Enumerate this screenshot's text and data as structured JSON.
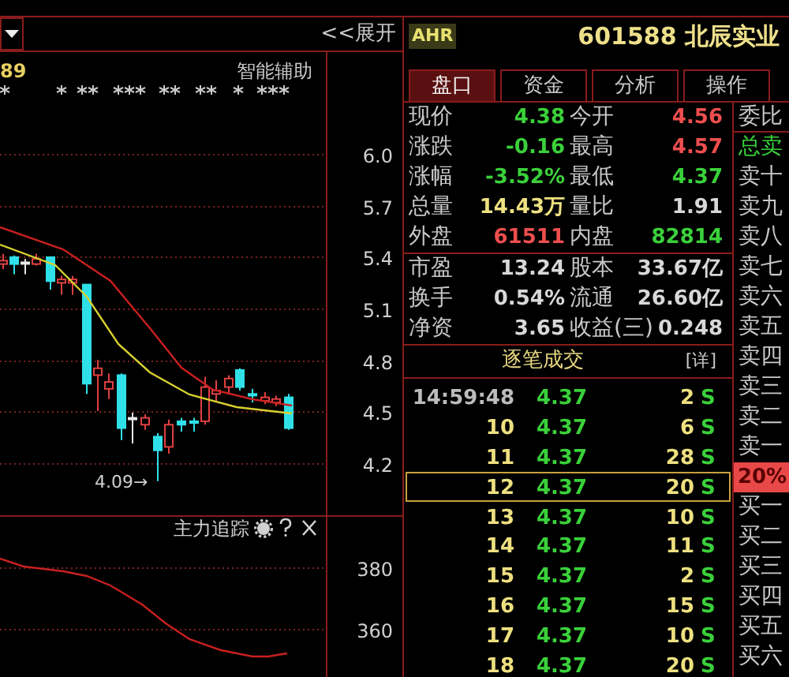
{
  "chart_header": {
    "expand_label": "<<展开"
  },
  "price_chart": {
    "corner_label": "89",
    "assist_label": "智能辅助",
    "yticks": [
      "6.0",
      "5.7",
      "5.4",
      "5.1",
      "4.8",
      "4.5",
      "4.2"
    ],
    "low_label": "4.09→"
  },
  "tracker_chart": {
    "title": "主力追踪",
    "yticks": [
      "380",
      "360"
    ]
  },
  "stock": {
    "badge": "AHR",
    "code_name": "601588 北辰实业"
  },
  "tabs": [
    {
      "label": "盘口",
      "selected": true
    },
    {
      "label": "资金",
      "selected": false
    },
    {
      "label": "分析",
      "selected": false
    },
    {
      "label": "操作",
      "selected": false
    }
  ],
  "quote_groups": [
    [
      {
        "cells": [
          {
            "label": "现价",
            "value": "4.38",
            "color": "#3ad13a"
          },
          {
            "label": "今开",
            "value": "4.56",
            "color": "#ee4e4e"
          }
        ]
      },
      {
        "cells": [
          {
            "label": "涨跌",
            "value": "-0.16",
            "color": "#3ad13a"
          },
          {
            "label": "最高",
            "value": "4.57",
            "color": "#ee4e4e"
          }
        ]
      },
      {
        "cells": [
          {
            "label": "涨幅",
            "value": "-3.52%",
            "color": "#3ad13a"
          },
          {
            "label": "最低",
            "value": "4.37",
            "color": "#3ad13a"
          }
        ]
      },
      {
        "cells": [
          {
            "label": "总量",
            "value": "14.43万",
            "color": "#eee080"
          },
          {
            "label": "量比",
            "value": "1.91",
            "color": "#d8d8d8"
          }
        ]
      },
      {
        "cells": [
          {
            "label": "外盘",
            "value": "61511",
            "color": "#ee4e4e"
          },
          {
            "label": "内盘",
            "value": "82814",
            "color": "#3ad13a"
          }
        ]
      }
    ],
    [
      {
        "cells": [
          {
            "label": "市盈",
            "value": "13.24",
            "color": "#d8d8d8"
          },
          {
            "label": "股本",
            "value": "33.67亿",
            "color": "#d8d8d8"
          }
        ]
      },
      {
        "cells": [
          {
            "label": "换手",
            "value": "0.54%",
            "color": "#d8d8d8"
          },
          {
            "label": "流通",
            "value": "26.60亿",
            "color": "#d8d8d8"
          }
        ]
      },
      {
        "cells": [
          {
            "label": "净资",
            "value": "3.65",
            "color": "#d8d8d8"
          },
          {
            "label": "收益(三)",
            "value": "0.248",
            "color": "#d8d8d8"
          }
        ]
      }
    ]
  ],
  "trades": {
    "title": "逐笔成交",
    "detail": "[详]",
    "rows": [
      {
        "time": "14:59:48",
        "kind": "full",
        "price": "4.37",
        "volume": "2",
        "side": "S",
        "selected": false
      },
      {
        "time": "10",
        "kind": "short",
        "price": "4.37",
        "volume": "6",
        "side": "S",
        "selected": false
      },
      {
        "time": "11",
        "kind": "short",
        "price": "4.37",
        "volume": "28",
        "side": "S",
        "selected": false
      },
      {
        "time": "12",
        "kind": "short",
        "price": "4.37",
        "volume": "20",
        "side": "S",
        "selected": true
      },
      {
        "time": "13",
        "kind": "short",
        "price": "4.37",
        "volume": "10",
        "side": "S",
        "selected": false
      },
      {
        "time": "14",
        "kind": "short",
        "price": "4.37",
        "volume": "11",
        "side": "S",
        "selected": false
      },
      {
        "time": "15",
        "kind": "short",
        "price": "4.37",
        "volume": "2",
        "side": "S",
        "selected": false
      },
      {
        "time": "16",
        "kind": "short",
        "price": "4.37",
        "volume": "15",
        "side": "S",
        "selected": false
      },
      {
        "time": "17",
        "kind": "short",
        "price": "4.37",
        "volume": "10",
        "side": "S",
        "selected": false
      },
      {
        "time": "18",
        "kind": "short",
        "price": "4.37",
        "volume": "20",
        "side": "S",
        "selected": false
      }
    ]
  },
  "order_book": {
    "ratio_label": "委比",
    "items": [
      {
        "label": "总卖",
        "kind": "total"
      },
      {
        "label": "卖十",
        "kind": "level"
      },
      {
        "label": "卖九",
        "kind": "level"
      },
      {
        "label": "卖八",
        "kind": "level"
      },
      {
        "label": "卖七",
        "kind": "level"
      },
      {
        "label": "卖六",
        "kind": "level"
      },
      {
        "label": "卖五",
        "kind": "level"
      },
      {
        "label": "卖四",
        "kind": "level"
      },
      {
        "label": "卖三",
        "kind": "level"
      },
      {
        "label": "卖二",
        "kind": "level"
      },
      {
        "label": "卖一",
        "kind": "level"
      },
      {
        "label": "20%",
        "kind": "ratio"
      },
      {
        "label": "买一",
        "kind": "level"
      },
      {
        "label": "买二",
        "kind": "level"
      },
      {
        "label": "买三",
        "kind": "level"
      },
      {
        "label": "买四",
        "kind": "level"
      },
      {
        "label": "买五",
        "kind": "level"
      },
      {
        "label": "买六",
        "kind": "level"
      }
    ]
  }
}
